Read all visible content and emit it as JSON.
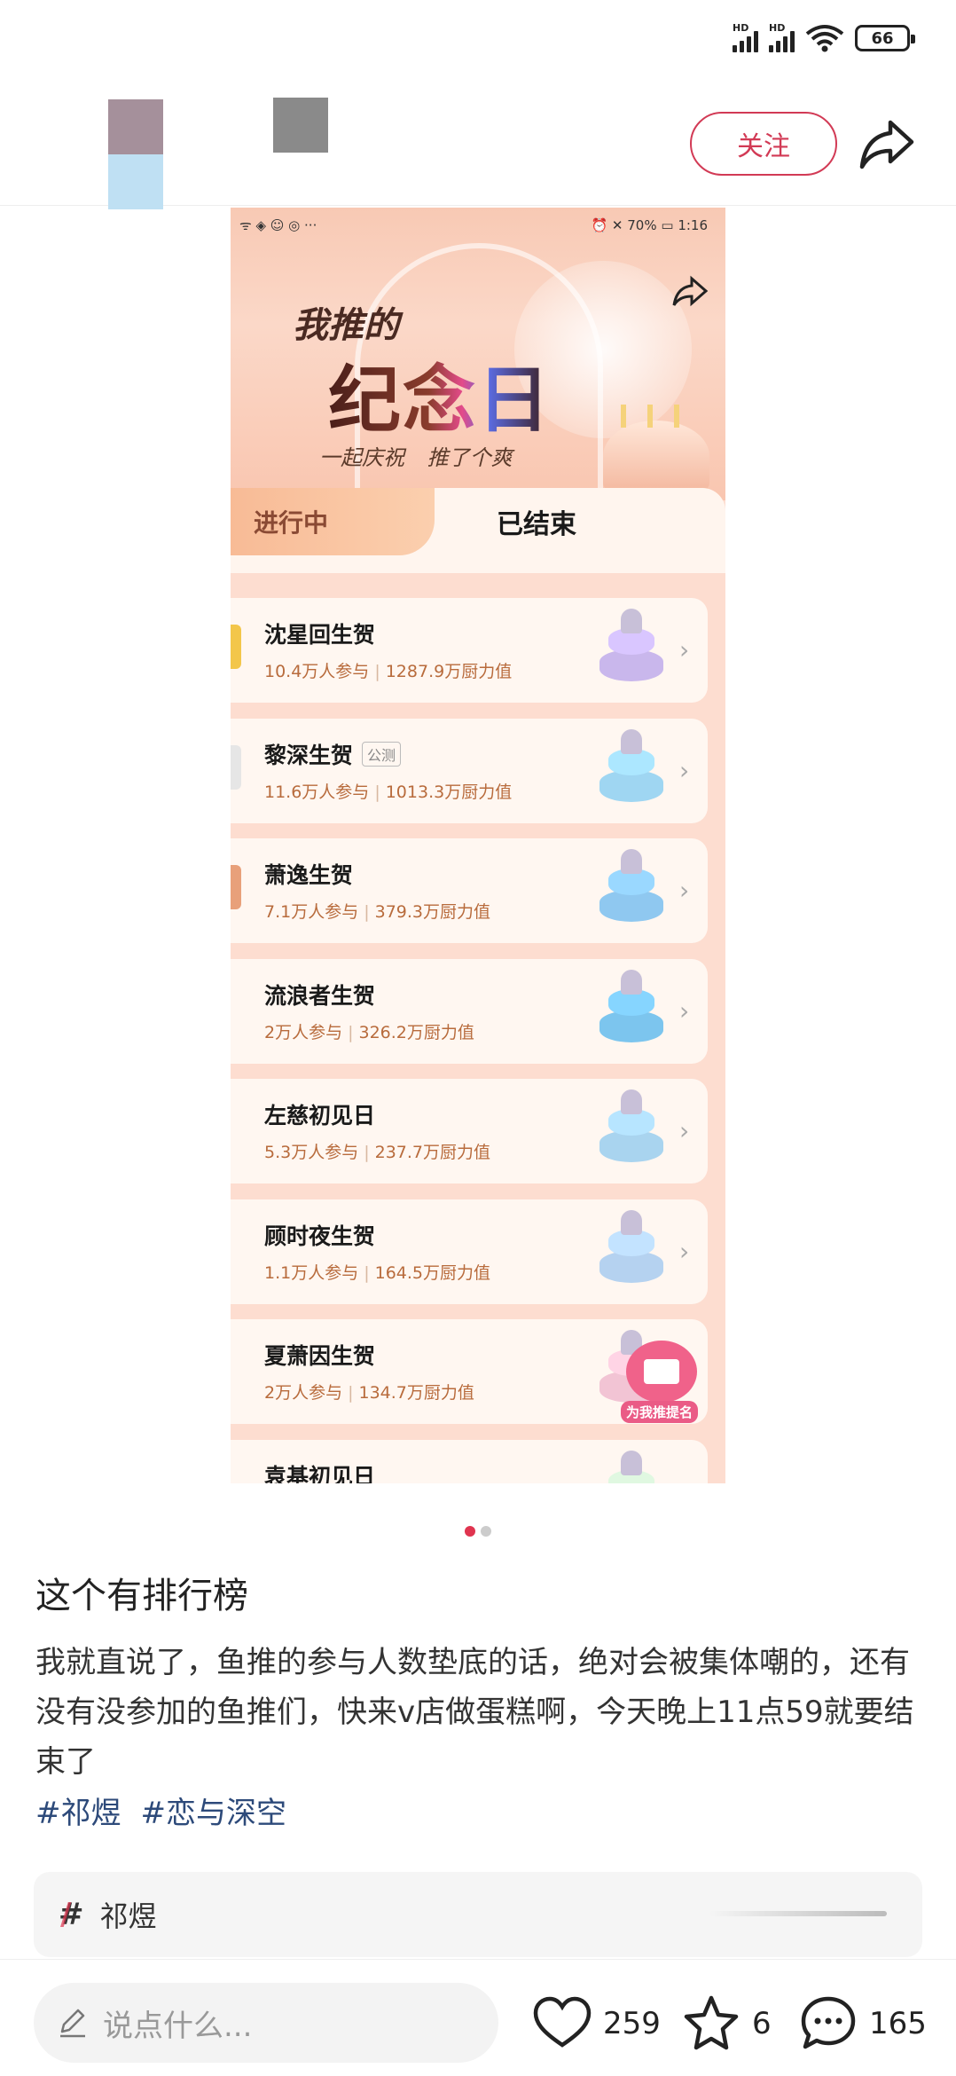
{
  "status_bar": {
    "battery": "66"
  },
  "header": {
    "follow_label": "关注"
  },
  "screenshot": {
    "status": {
      "battery_pct": "70%",
      "time": "1:16"
    },
    "banner": {
      "line1": "我推的",
      "line2": "纪念日",
      "tagline": "一起庆祝 推了个爽"
    },
    "tabs": {
      "ongoing": "进行中",
      "ended": "已结束"
    },
    "items": [
      {
        "name": "沈星回生贺",
        "tag": "",
        "participants": "10.4万人参与",
        "power": "1287.9万厨力值",
        "cake_color": "#c9b7ec",
        "side_color": "#f3c64a"
      },
      {
        "name": "黎深生贺",
        "tag": "公测",
        "participants": "11.6万人参与",
        "power": "1013.3万厨力值",
        "cake_color": "#9fd6f2",
        "side_color": "#e6e6e6"
      },
      {
        "name": "萧逸生贺",
        "tag": "",
        "participants": "7.1万人参与",
        "power": "379.3万厨力值",
        "cake_color": "#8fc8f0",
        "side_color": "#e8a07a"
      },
      {
        "name": "流浪者生贺",
        "tag": "",
        "participants": "2万人参与",
        "power": "326.2万厨力值",
        "cake_color": "#7cc5ee",
        "side_color": ""
      },
      {
        "name": "左慈初见日",
        "tag": "",
        "participants": "5.3万人参与",
        "power": "237.7万厨力值",
        "cake_color": "#a9d4ef",
        "side_color": ""
      },
      {
        "name": "顾时夜生贺",
        "tag": "",
        "participants": "1.1万人参与",
        "power": "164.5万厨力值",
        "cake_color": "#b5d2f0",
        "side_color": ""
      },
      {
        "name": "夏萧因生贺",
        "tag": "",
        "participants": "2万人参与",
        "power": "134.7万厨力值",
        "cake_color": "#f2c4d4",
        "side_color": ""
      },
      {
        "name": "袁基初见日",
        "tag": "",
        "participants": "",
        "power": "",
        "cake_color": "#cfe6d0",
        "side_color": ""
      }
    ],
    "vote_badge": "为我推提名"
  },
  "post": {
    "title": "这个有排行榜",
    "body": "我就直说了，鱼推的参与人数垫底的话，绝对会被集体嘲的，还有没有没参加的鱼推们，快来v店做蛋糕啊，今天晚上11点59就要结束了",
    "tags": [
      "#祁煜",
      "#恋与深空"
    ]
  },
  "topic": {
    "label": "祁煜"
  },
  "bottom_bar": {
    "comment_placeholder": "说点什么...",
    "likes": "259",
    "favorites": "6",
    "comments": "165"
  },
  "colors": {
    "accent": "#e0344f",
    "tag_link": "#2d4a7a",
    "stats": "#b86b3c"
  }
}
